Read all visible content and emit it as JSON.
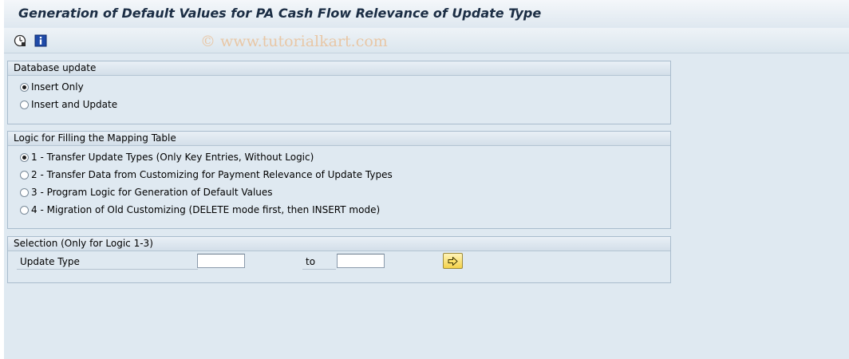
{
  "header": {
    "title": "Generation of Default Values for PA Cash Flow Relevance of Update Type"
  },
  "toolbar": {
    "icons": [
      "execute-clock-icon",
      "info-icon"
    ],
    "watermark": "© www.tutorialkart.com"
  },
  "database_update": {
    "title": "Database update",
    "options": [
      {
        "label": "Insert Only",
        "selected": true
      },
      {
        "label": "Insert and Update",
        "selected": false
      }
    ]
  },
  "logic": {
    "title": "Logic for Filling the Mapping Table",
    "options": [
      {
        "label": "1 - Transfer Update Types (Only Key Entries, Without Logic)",
        "selected": true
      },
      {
        "label": "2 - Transfer Data from Customizing for Payment Relevance of Update Types",
        "selected": false
      },
      {
        "label": "3 - Program Logic for Generation of Default Values",
        "selected": false
      },
      {
        "label": "4 - Migration of Old Customizing (DELETE mode first, then INSERT mode)",
        "selected": false
      }
    ]
  },
  "selection": {
    "title": "Selection (Only for Logic 1-3)",
    "field_label": "Update Type",
    "to_label": "to",
    "from_value": "",
    "to_value": ""
  },
  "colors": {
    "background": "#dfe9f1",
    "title_text": "#1b2d44",
    "watermark": "#e8c7a6",
    "exec_button": "#f4d24a"
  }
}
